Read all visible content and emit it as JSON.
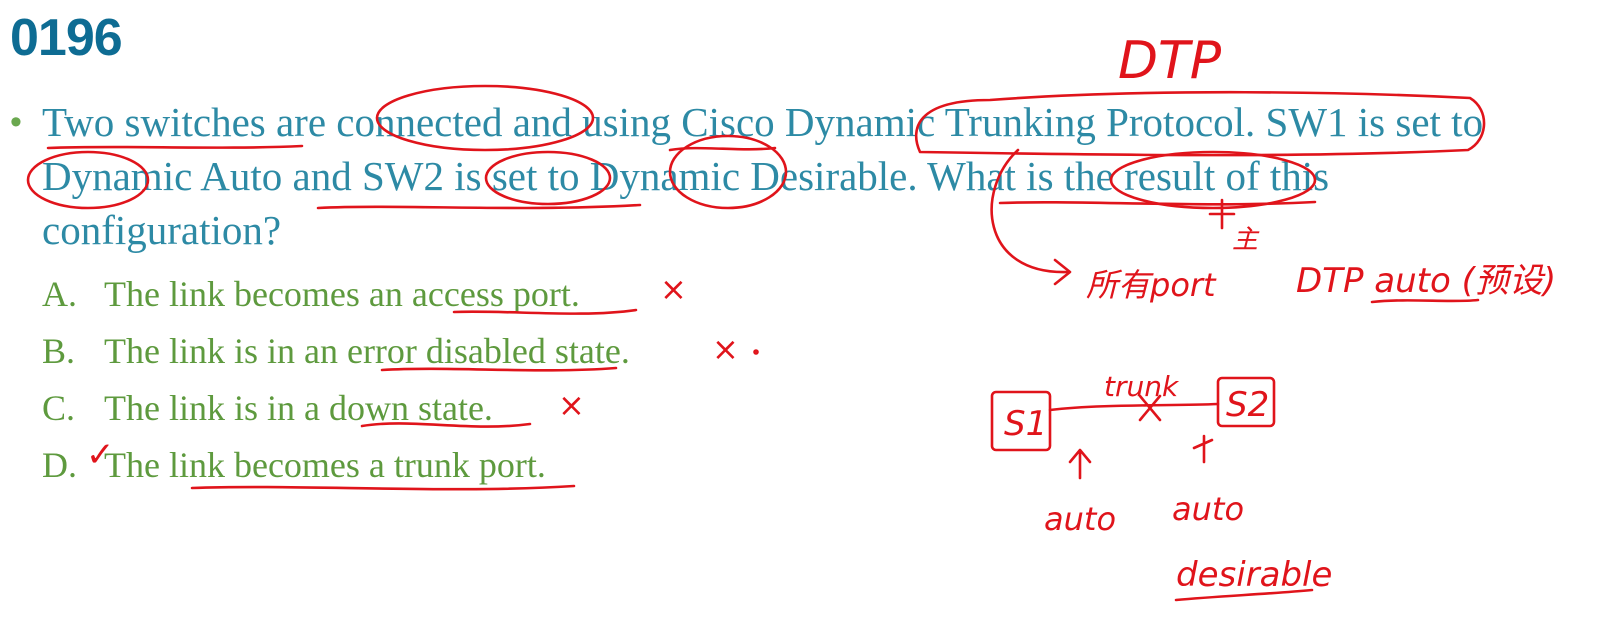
{
  "slide": {
    "title": "0196",
    "question_bullet": "•",
    "question_text": "Two switches are connected and using Cisco Dynamic Trunking Protocol. SW1 is set to Dynamic Auto and SW2 is set to Dynamic Desirable. What is the result of this configuration?",
    "options": [
      {
        "letter": "A.",
        "text": "The link becomes an access port."
      },
      {
        "letter": "B.",
        "text": "The link is in an error disabled state."
      },
      {
        "letter": "C.",
        "text": "The link is in a down state."
      },
      {
        "letter": "D.",
        "text": "The link becomes a trunk port."
      }
    ]
  },
  "annotations": {
    "dtp_header": "DTP",
    "chinese_note": "主",
    "all_ports_note": "所有port",
    "dtp_auto_note": "DTP auto (预设)",
    "switch_left": "S1",
    "switch_right": "S2",
    "link_label": "trunk",
    "left_mode": "auto",
    "right_mode": "auto",
    "right_mode_alt": "desirable",
    "mark_wrong": "×",
    "mark_right": "✓"
  },
  "colors": {
    "title": "#0e6c93",
    "question": "#2d8aa5",
    "bullet": "#6aa84f",
    "options": "#5e9a3e",
    "ink": "#e0141b"
  }
}
